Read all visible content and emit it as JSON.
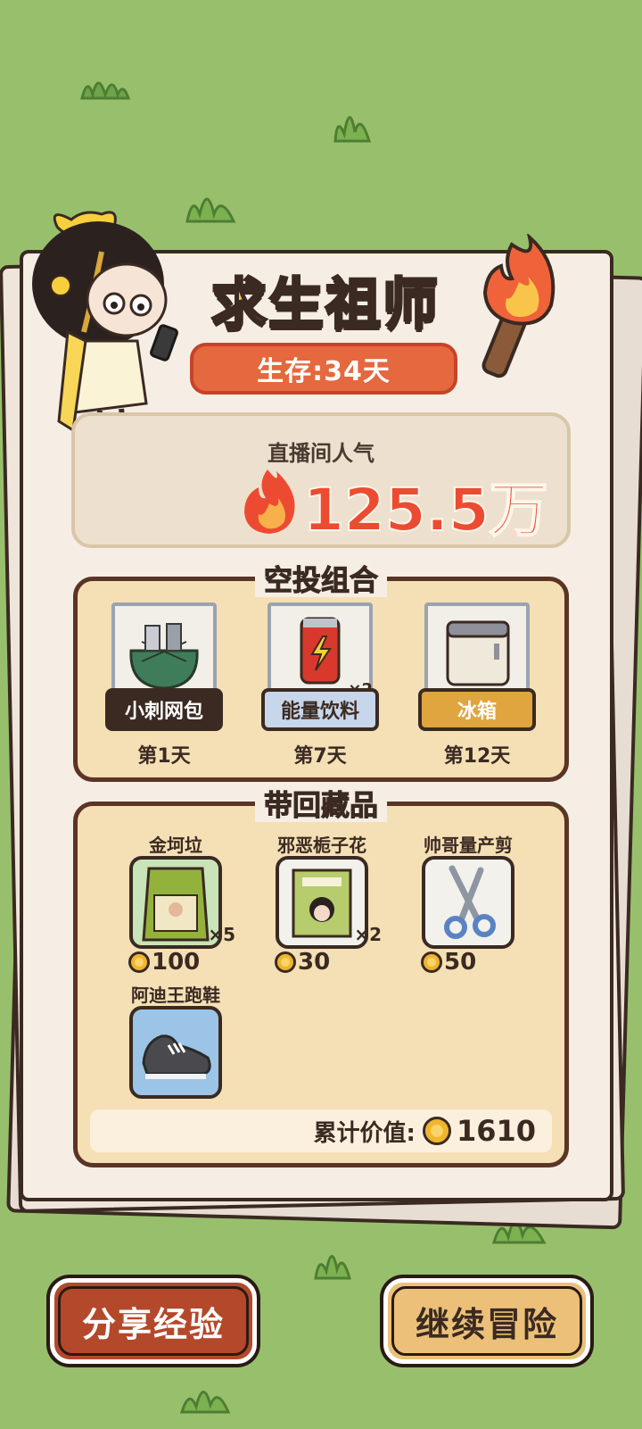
{
  "title": "求生祖师",
  "survival": "生存:34天",
  "popularity": {
    "label": "直播间人气",
    "value": "125.5万"
  },
  "airdrop": {
    "title": "空投组合",
    "items": [
      {
        "name": "小刺网包",
        "day": "第1天",
        "icon": "net-bag-icon",
        "label_color": "#3a2a22",
        "label_text_color": "#ffffff"
      },
      {
        "name": "能量饮料",
        "day": "第7天",
        "qty": "×2",
        "icon": "energy-drink-icon",
        "label_color": "#c7d6ea",
        "label_text_color": "#3a2a22"
      },
      {
        "name": "冰箱",
        "day": "第12天",
        "icon": "fridge-icon",
        "label_color": "#e0a53e",
        "label_text_color": "#ffffff"
      }
    ]
  },
  "collection": {
    "title": "带回藏品",
    "items": [
      {
        "name": "金坷垃",
        "price": "100",
        "qty": "×5",
        "icon": "fertilizer-bag-icon"
      },
      {
        "name": "邪恶栀子花",
        "price": "30",
        "qty": "×2",
        "icon": "book-icon"
      },
      {
        "name": "帅哥量产剪",
        "price": "50",
        "icon": "scissors-icon"
      },
      {
        "name": "阿迪王跑鞋",
        "icon": "sneaker-icon"
      }
    ],
    "total_label": "累计价值:",
    "total_value": "1610"
  },
  "buttons": {
    "share": "分享经验",
    "continue": "继续冒险"
  }
}
